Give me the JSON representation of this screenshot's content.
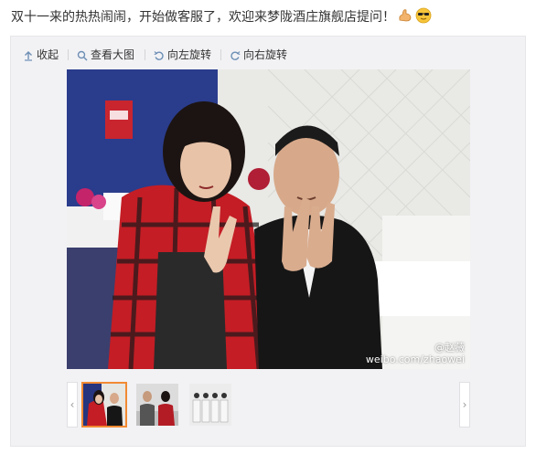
{
  "post": {
    "text": "双十一来的热热闹闹，开始做客服了，欢迎来梦陇酒庄旗舰店提问！",
    "emojis": [
      "flexed-biceps-icon",
      "sunglasses-face-icon"
    ]
  },
  "toolbar": {
    "collapse_label": "收起",
    "view_large_label": "查看大图",
    "rotate_left_label": "向左旋转",
    "rotate_right_label": "向右旋转"
  },
  "photo": {
    "watermark_user": "@赵薇",
    "watermark_url": "weibo.com/zhaowei"
  },
  "thumbnails": {
    "count": 3,
    "active_index": 0
  },
  "colors": {
    "active_border": "#f28a33",
    "toolbar_icon": "#6e8fb5",
    "background": "#f2f2f5"
  }
}
